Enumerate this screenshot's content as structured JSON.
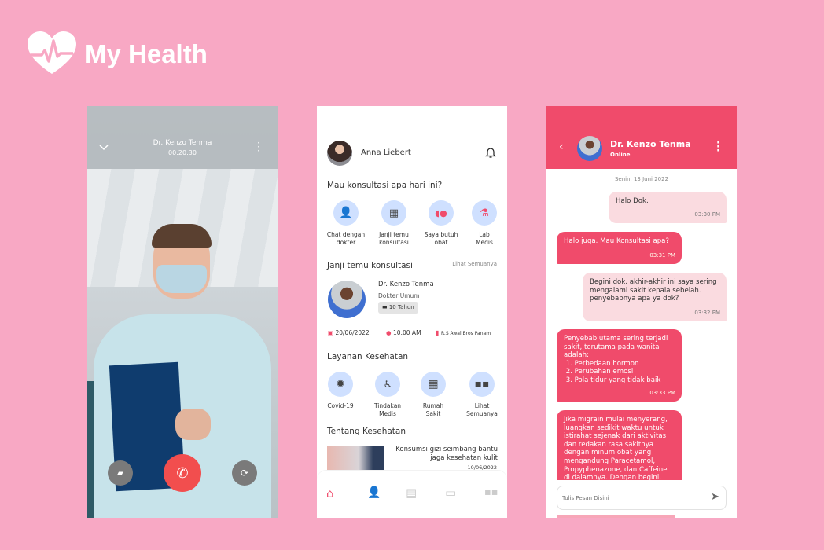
{
  "brand": {
    "name": "My Health"
  },
  "video_call": {
    "doctor": "Dr. Kenzo Tenma",
    "duration": "00:20:30",
    "icons": [
      "chevron-down-icon",
      "more-vert-icon",
      "camera-off-icon",
      "end-call-icon",
      "switch-camera-icon"
    ],
    "end_call_color": "#F24E4E"
  },
  "home": {
    "user": "Anna Liebert",
    "question": "Mau konsultasi apa hari ini?",
    "quick": [
      {
        "label": "Chat dengan dokter",
        "icon": "doctor-icon"
      },
      {
        "label": "Janji temu konsultasi",
        "icon": "calendar-clock-icon"
      },
      {
        "label": "Saya butuh obat",
        "icon": "pill-icon"
      },
      {
        "label": "Lab Medis",
        "icon": "flask-icon"
      }
    ],
    "appointments_title": "Janji temu konsultasi",
    "see_all": "Lihat Semuanya",
    "appointment": {
      "doctor": "Dr. Kenzo Tenma",
      "specialty": "Dokter Umum",
      "experience": "10 Tahun",
      "date": "20/06/2022",
      "time": "10:00 AM",
      "place": "R.S Awal Bros Panam"
    },
    "services_title": "Layanan Kesehatan",
    "services": [
      {
        "label": "Covid-19",
        "icon": "virus-icon"
      },
      {
        "label": "Tindakan Medis",
        "icon": "medical-procedure-icon"
      },
      {
        "label": "Rumah Sakit",
        "icon": "hospital-icon"
      },
      {
        "label": "Lihat Semuanya",
        "icon": "grid-icon"
      }
    ],
    "articles_title": "Tentang Kesehatan",
    "article": {
      "title": "Konsumsi gizi seimbang bantu jaga kesehatan kulit",
      "date": "10/06/2022"
    },
    "nav": [
      "home-icon",
      "doctor-icon",
      "store-icon",
      "chat-icon",
      "grid-icon"
    ],
    "accent": "#F04B6B"
  },
  "chat": {
    "doctor": "Dr. Kenzo Tenma",
    "status": "Online",
    "date": "Senin, 13 Juni 2022",
    "messages": [
      {
        "from": "me",
        "text": "Halo Dok.",
        "time": "03:30 PM"
      },
      {
        "from": "doctor",
        "text": "Halo juga. Mau Konsultasi apa?",
        "time": "03:31 PM"
      },
      {
        "from": "me",
        "text": "Begini dok, akhir-akhir ini saya sering mengalami sakit kepala sebelah. penyebabnya apa ya dok?",
        "time": "03:32 PM"
      },
      {
        "from": "doctor",
        "text": "Penyebab utama sering terjadi sakit, terutama pada wanita adalah:\n 1. Perbedaan hormon\n 2. Perubahan emosi\n 3. Pola tidur yang tidak baik",
        "time": "03:33 PM"
      },
      {
        "from": "doctor",
        "text": "Jika migrain mulai menyerang, luangkan sedikit waktu untuk istirahat sejenak dari aktivitas dan redakan rasa sakitnya dengan minum obat yang mengandung Paracetamol, Propyphenazone, dan Caffeine di dalamnya. Dengan begini, sakit"
      }
    ],
    "placeholder": "Tulis Pesan Disini",
    "header_color": "#F04B6B"
  }
}
